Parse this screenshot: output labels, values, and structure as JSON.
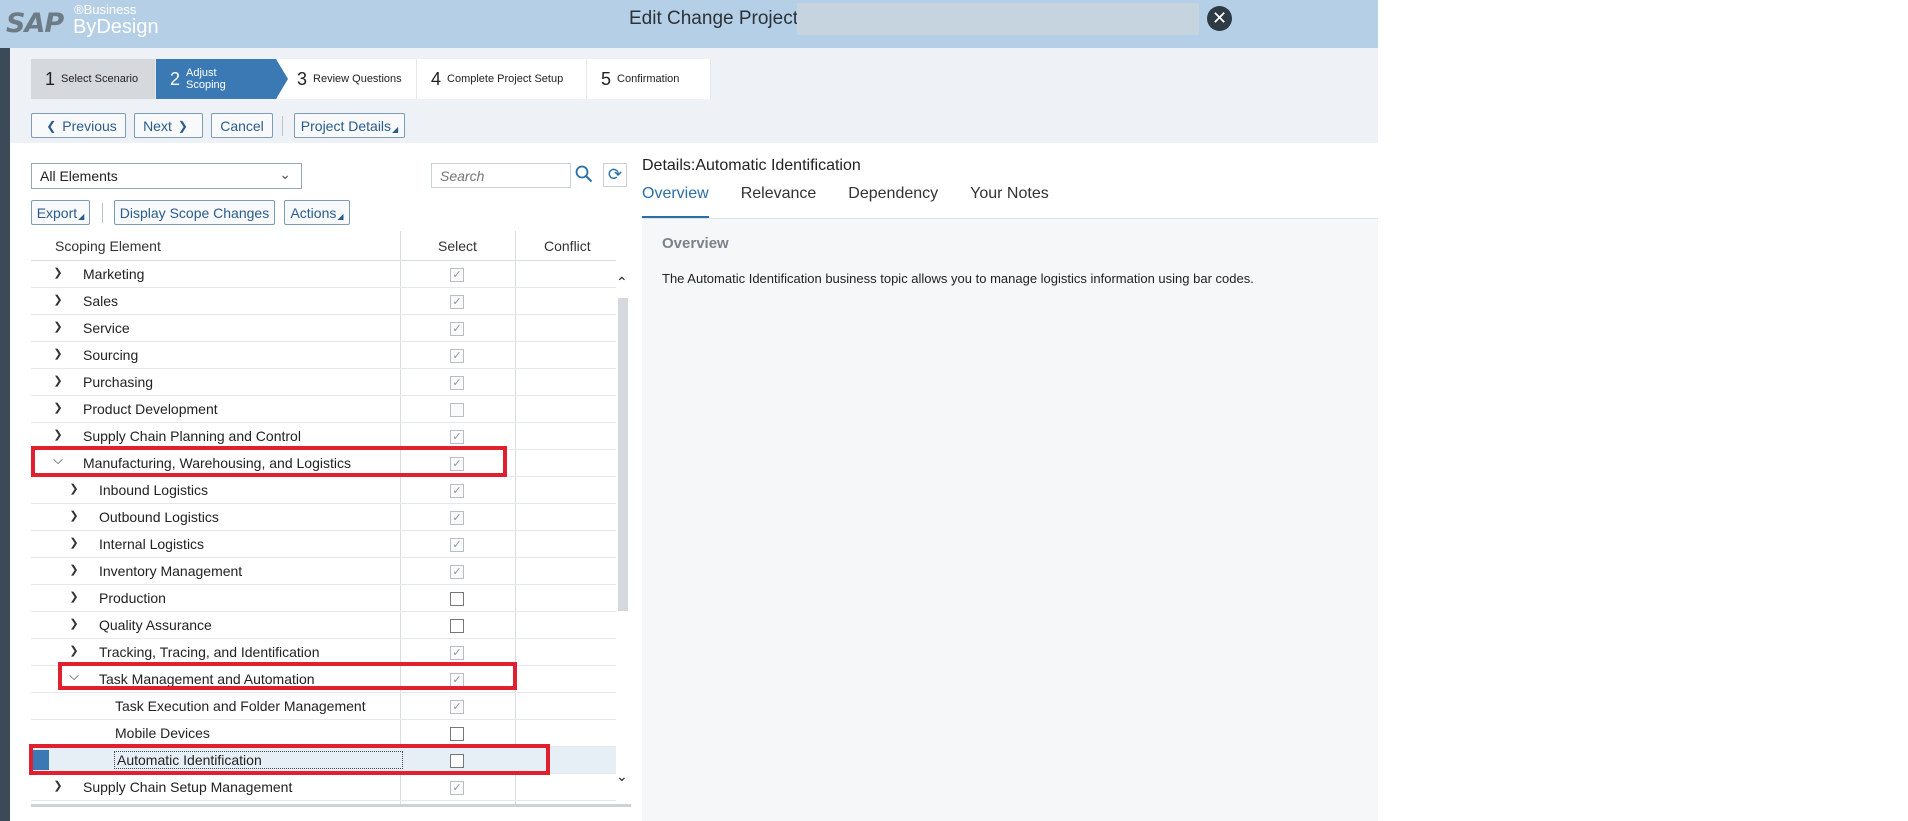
{
  "header": {
    "logo_sap": "SAP",
    "logo_business": "®Business",
    "logo_bydesign": "ByDesign",
    "title": "Edit Change Project:",
    "close_icon": "close-icon"
  },
  "steps": [
    {
      "num": "1",
      "label": "Select Scenario"
    },
    {
      "num": "2",
      "label": "Adjust Scoping"
    },
    {
      "num": "3",
      "label": "Review Questions"
    },
    {
      "num": "4",
      "label": "Complete Project Setup"
    },
    {
      "num": "5",
      "label": "Confirmation"
    }
  ],
  "toolbar": {
    "previous": "Previous",
    "next": "Next",
    "cancel": "Cancel",
    "project_details": "Project Details"
  },
  "filter": {
    "dropdown_value": "All Elements",
    "search_placeholder": "Search"
  },
  "table_toolbar": {
    "export": "Export",
    "display_scope_changes": "Display Scope Changes",
    "actions": "Actions"
  },
  "table": {
    "headers": [
      "Scoping Element",
      "Select",
      "Conflict"
    ],
    "rows": [
      {
        "label": "Marketing",
        "level": 0,
        "expand": "collapsed",
        "checked": true,
        "disabled": true
      },
      {
        "label": "Sales",
        "level": 0,
        "expand": "collapsed",
        "checked": true,
        "disabled": true
      },
      {
        "label": "Service",
        "level": 0,
        "expand": "collapsed",
        "checked": true,
        "disabled": true
      },
      {
        "label": "Sourcing",
        "level": 0,
        "expand": "collapsed",
        "checked": true,
        "disabled": true
      },
      {
        "label": "Purchasing",
        "level": 0,
        "expand": "collapsed",
        "checked": true,
        "disabled": true
      },
      {
        "label": "Product Development",
        "level": 0,
        "expand": "collapsed",
        "checked": false,
        "disabled": true
      },
      {
        "label": "Supply Chain Planning and Control",
        "level": 0,
        "expand": "collapsed",
        "checked": true,
        "disabled": true
      },
      {
        "label": "Manufacturing, Warehousing, and Logistics",
        "level": 0,
        "expand": "expanded",
        "checked": true,
        "disabled": true
      },
      {
        "label": "Inbound Logistics",
        "level": 1,
        "expand": "collapsed",
        "checked": true,
        "disabled": true
      },
      {
        "label": "Outbound Logistics",
        "level": 1,
        "expand": "collapsed",
        "checked": true,
        "disabled": true
      },
      {
        "label": "Internal Logistics",
        "level": 1,
        "expand": "collapsed",
        "checked": true,
        "disabled": true
      },
      {
        "label": "Inventory Management",
        "level": 1,
        "expand": "collapsed",
        "checked": true,
        "disabled": true
      },
      {
        "label": "Production",
        "level": 1,
        "expand": "collapsed",
        "checked": false,
        "disabled": false
      },
      {
        "label": "Quality Assurance",
        "level": 1,
        "expand": "collapsed",
        "checked": false,
        "disabled": false
      },
      {
        "label": "Tracking, Tracing, and Identification",
        "level": 1,
        "expand": "collapsed",
        "checked": true,
        "disabled": true
      },
      {
        "label": "Task Management and Automation",
        "level": 1,
        "expand": "expanded",
        "checked": true,
        "disabled": true
      },
      {
        "label": "Task Execution and Folder Management",
        "level": 2,
        "expand": "none",
        "checked": true,
        "disabled": true
      },
      {
        "label": "Mobile Devices",
        "level": 2,
        "expand": "none",
        "checked": false,
        "disabled": false
      },
      {
        "label": "Automatic Identification",
        "level": 2,
        "expand": "none",
        "checked": false,
        "disabled": false,
        "selected": true
      },
      {
        "label": "Supply Chain Setup Management",
        "level": 0,
        "expand": "collapsed",
        "checked": true,
        "disabled": true
      }
    ]
  },
  "details": {
    "title": "Details:Automatic Identification",
    "tabs": [
      "Overview",
      "Relevance",
      "Dependency",
      "Your Notes"
    ],
    "overview_heading": "Overview",
    "overview_text": "The Automatic Identification business topic allows you to manage logistics information using bar codes."
  },
  "colors": {
    "header_bg": "#b4cfe6",
    "active_step": "#3a79b3",
    "highlight": "#e0202e",
    "link": "#2b6ea8"
  }
}
